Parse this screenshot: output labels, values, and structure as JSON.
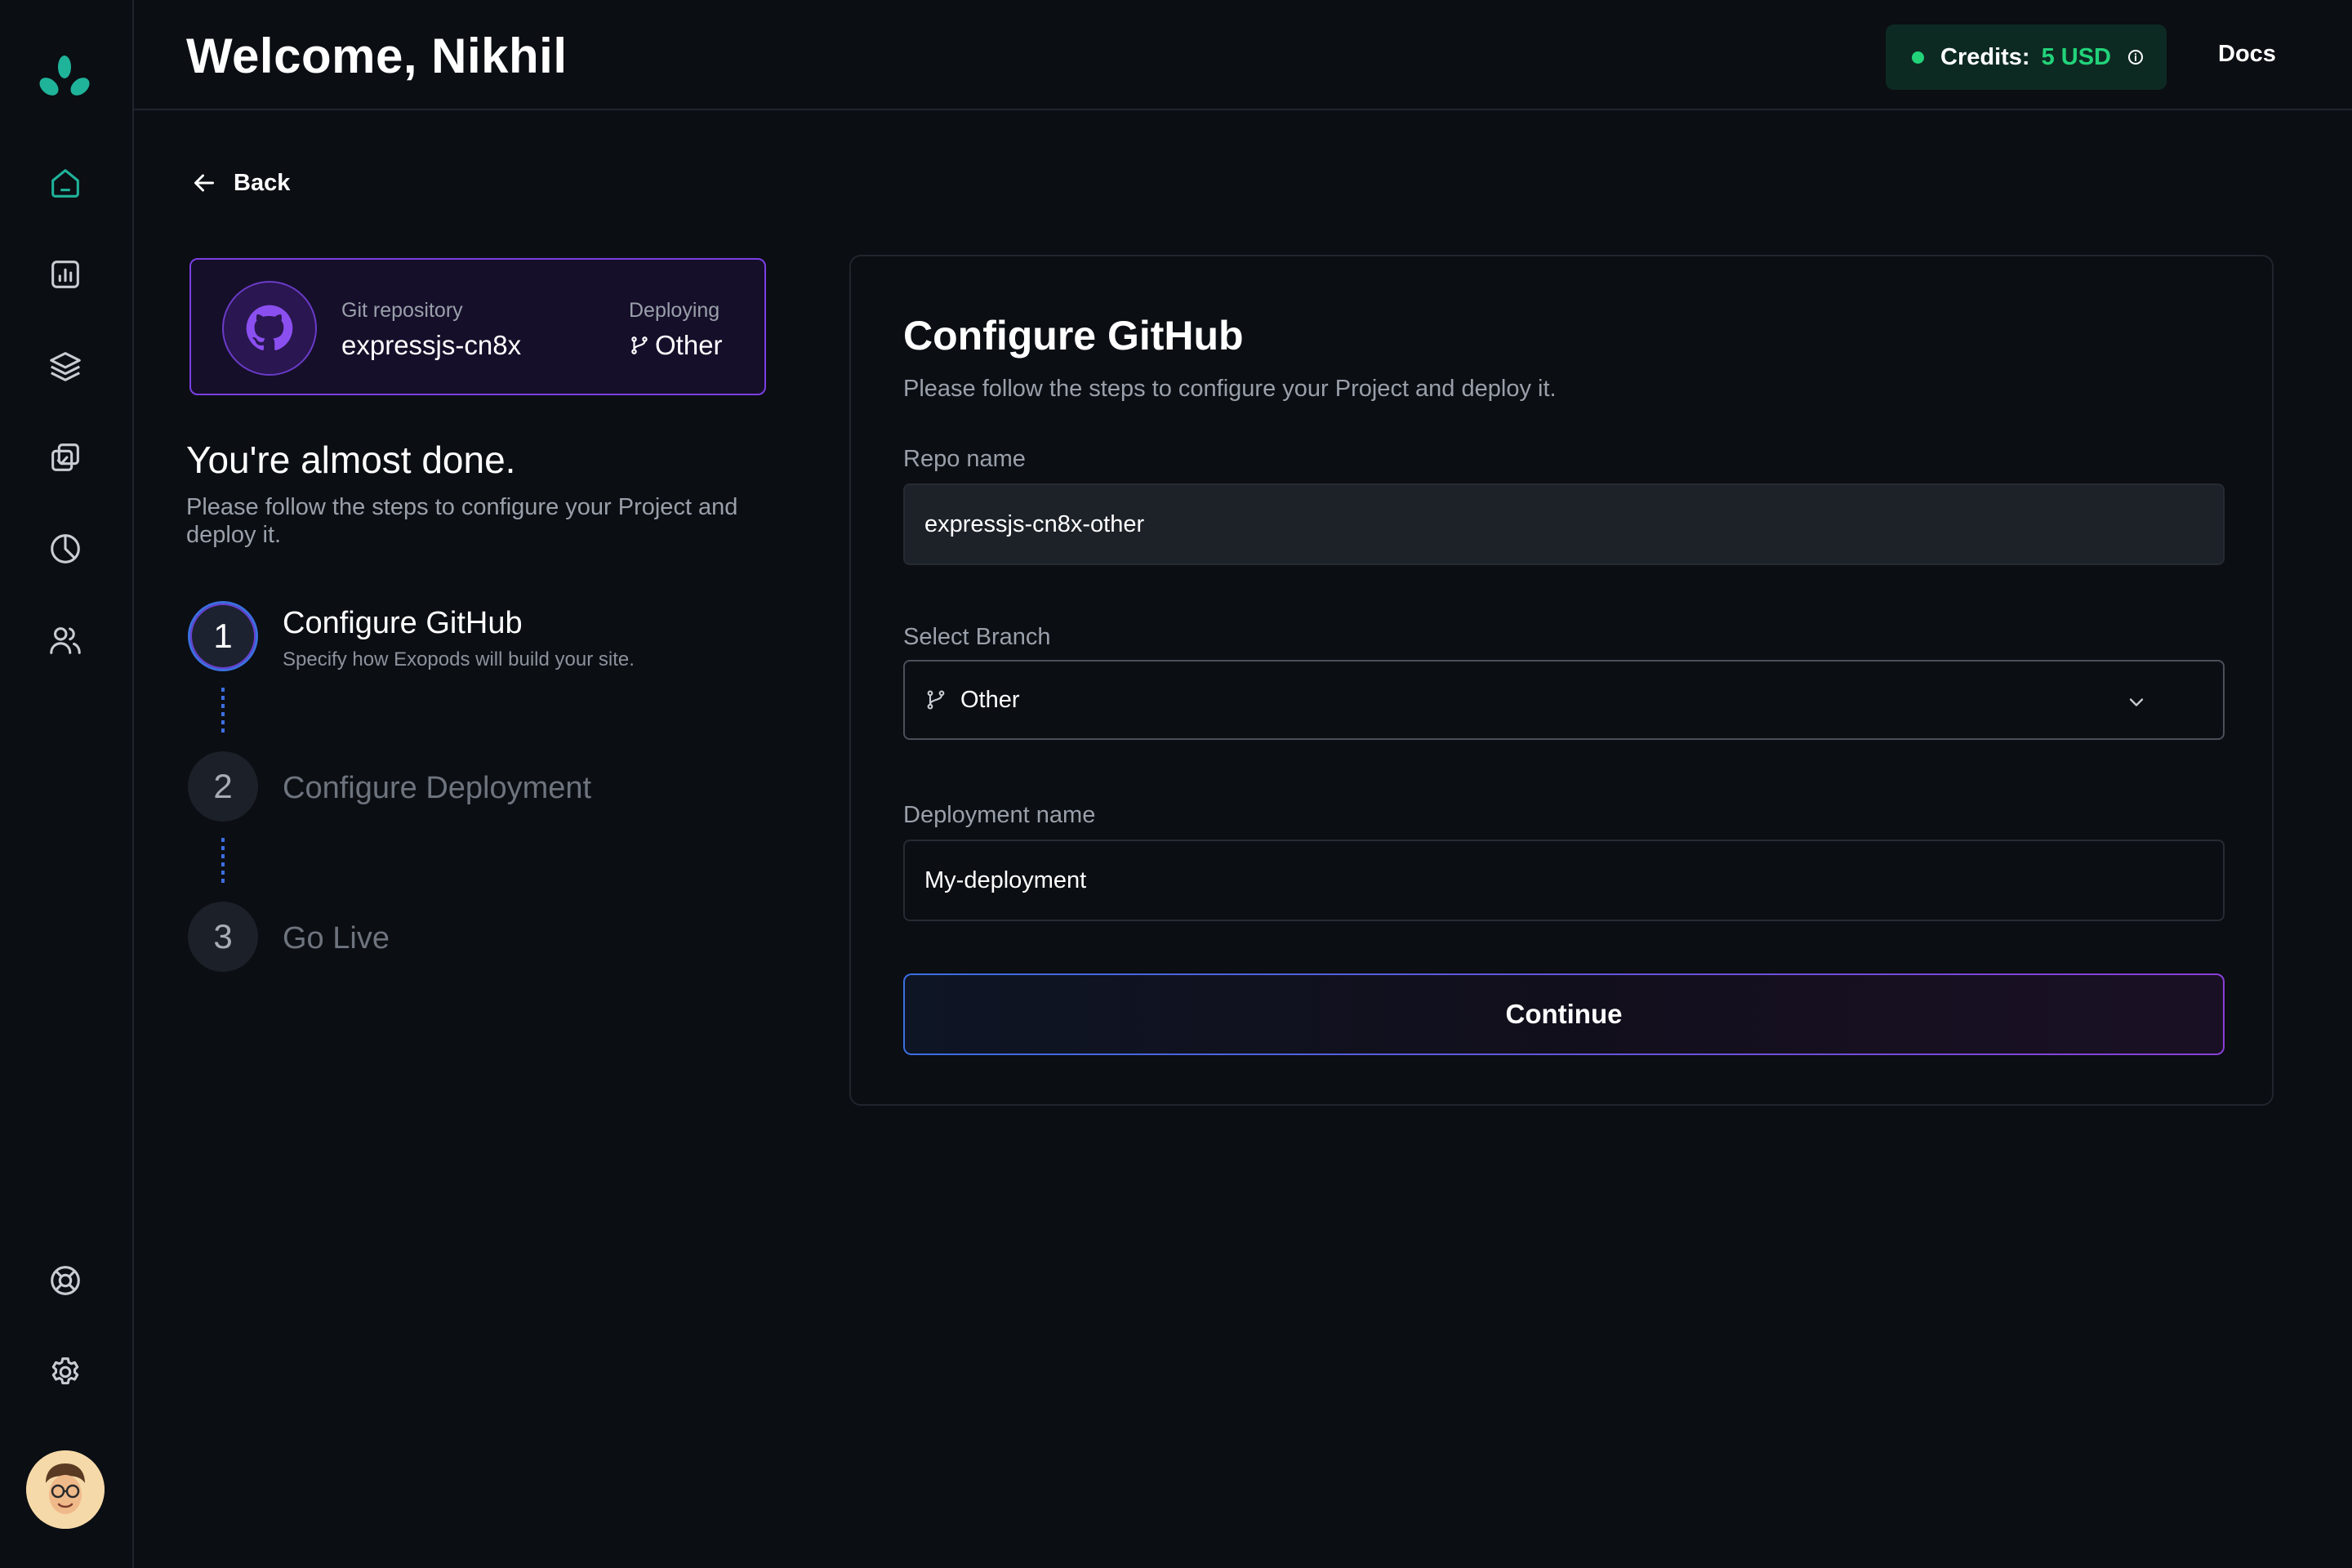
{
  "header": {
    "welcome": "Welcome, Nikhil",
    "credits_label": "Credits:",
    "credits_value": "5 USD",
    "docs_label": "Docs"
  },
  "sidebar": {
    "items": [
      {
        "icon": "home-icon"
      },
      {
        "icon": "bar-chart-icon"
      },
      {
        "icon": "layers-icon"
      },
      {
        "icon": "copy-check-icon"
      },
      {
        "icon": "pie-chart-icon"
      },
      {
        "icon": "users-icon"
      }
    ],
    "bottom": [
      {
        "icon": "life-buoy-icon"
      },
      {
        "icon": "gear-icon"
      }
    ]
  },
  "back_label": "Back",
  "repo_card": {
    "repo_label": "Git repository",
    "repo_value": "expressjs-cn8x",
    "deploy_label": "Deploying",
    "deploy_value": "Other"
  },
  "intro": {
    "title": "You're almost done.",
    "subtitle": "Please follow the steps to configure your Project and deploy it."
  },
  "steps": [
    {
      "number": "1",
      "title": "Configure GitHub",
      "description": "Specify how Exopods will build your site.",
      "active": true
    },
    {
      "number": "2",
      "title": "Configure Deployment",
      "active": false
    },
    {
      "number": "3",
      "title": "Go Live",
      "active": false
    }
  ],
  "panel": {
    "title": "Configure GitHub",
    "subtitle": "Please follow the steps to configure your Project and deploy it.",
    "repo_name_label": "Repo name",
    "repo_name_value": "expressjs-cn8x-other",
    "branch_label": "Select Branch",
    "branch_value": "Other",
    "deployment_name_label": "Deployment name",
    "deployment_name_value": "My-deployment",
    "continue_label": "Continue"
  },
  "colors": {
    "accent_green": "#22d37a",
    "accent_purple": "#7b3fe4",
    "accent_blue": "#3b6fe0",
    "background": "#0b0e13"
  }
}
